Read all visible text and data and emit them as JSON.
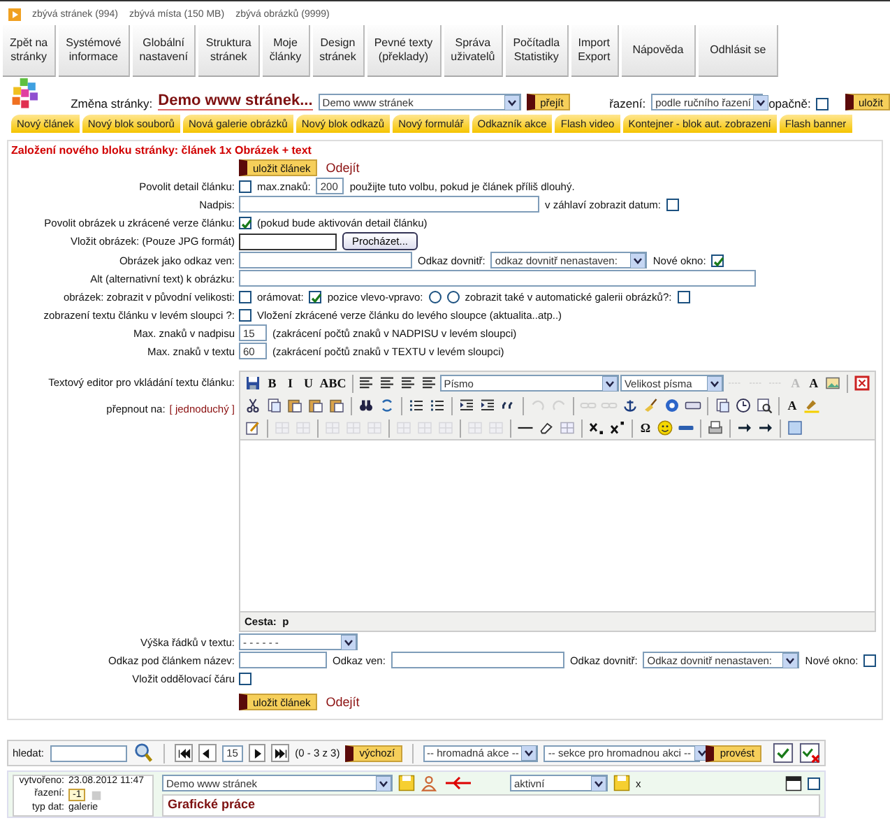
{
  "top_info": [
    "zbývá stránek (994)",
    "zbývá místa (150 MB)",
    "zbývá obrázků (9999)"
  ],
  "nav": [
    {
      "lines": [
        "Zpět na",
        "stránky"
      ]
    },
    {
      "lines": [
        "Systémové",
        "informace"
      ]
    },
    {
      "lines": [
        "Globální",
        "nastavení"
      ]
    },
    {
      "lines": [
        "Struktura",
        "stránek"
      ]
    },
    {
      "lines": [
        "Moje",
        "články"
      ]
    },
    {
      "lines": [
        "Design",
        "stránek"
      ]
    },
    {
      "lines": [
        "Pevné texty",
        "(překlady)"
      ]
    },
    {
      "lines": [
        "Správa",
        "uživatelů"
      ]
    },
    {
      "lines": [
        "Počítadla",
        "Statistiky"
      ]
    },
    {
      "lines": [
        "Import",
        "Export"
      ]
    },
    {
      "lines": [
        "Nápověda"
      ]
    },
    {
      "lines": [
        "Odhlásit se"
      ]
    }
  ],
  "page_switch": {
    "label": "Změna stránky:",
    "title": "Demo www stránek...",
    "select": "Demo www stránek",
    "go": "přejít",
    "sort_label": "řazení:",
    "sort_select": "podle ručního řazení",
    "reverse_label": "opačně:",
    "reverse_checked": false,
    "save": "uložit"
  },
  "new_block_buttons": [
    "Nový článek",
    "Nový blok souborů",
    "Nová galerie obrázků",
    "Nový blok odkazů",
    "Nový formulář",
    "Odkazník akce",
    "Flash video",
    "Kontejner - blok aut. zobrazení",
    "Flash banner"
  ],
  "form": {
    "title": "Založení nového bloku stránky: článek 1x Obrázek + text",
    "save": "uložit článek",
    "cancel": "Odejít",
    "save_bottom": "uložit článek",
    "cancel_bottom": "Odejít",
    "rows_top": [
      {
        "label": "Povolit detail článku:",
        "parts": [
          {
            "kind": "checkbox",
            "checked": false
          },
          {
            "kind": "text",
            "text": "max.znaků:"
          },
          {
            "kind": "input_tiny",
            "value": "200"
          },
          {
            "kind": "text",
            "text": "použijte tuto volbu, pokud je článek příliš dlouhý."
          }
        ]
      },
      {
        "label": "Nadpis:",
        "parts": [
          {
            "kind": "input_long"
          },
          {
            "kind": "text",
            "text": "v záhlaví zobrazit datum:"
          },
          {
            "kind": "checkbox",
            "checked": false
          }
        ]
      },
      {
        "label": "Povolit obrázek u zkrácené verze článku:",
        "parts": [
          {
            "kind": "checkbox",
            "checked": true
          },
          {
            "kind": "text",
            "text": "(pokud bude aktivován detail článku)"
          }
        ]
      },
      {
        "label": "Vložit obrázek: (Pouze JPG formát)",
        "parts": [
          {
            "kind": "input_file"
          },
          {
            "kind": "button",
            "label": "Procházet..."
          }
        ]
      },
      {
        "label": "Obrázek jako odkaz ven:",
        "parts": [
          {
            "kind": "input_mid"
          },
          {
            "kind": "text",
            "text": "Odkaz dovnitř:"
          },
          {
            "kind": "select",
            "value": "odkaz dovnitř nenastaven:"
          },
          {
            "kind": "text",
            "text": "Nové okno:"
          },
          {
            "kind": "checkbox",
            "checked": true
          }
        ]
      },
      {
        "label": "Alt (alternativní text) k obrázku:",
        "parts": [
          {
            "kind": "input_wide"
          }
        ]
      },
      {
        "label": "obrázek: zobrazit v původní velikosti:",
        "parts": [
          {
            "kind": "checkbox",
            "checked": false
          },
          {
            "kind": "text",
            "text": "orámovat:"
          },
          {
            "kind": "checkbox",
            "checked": true
          },
          {
            "kind": "text",
            "text": "pozice vlevo-vpravo:"
          },
          {
            "kind": "radio",
            "selected": false
          },
          {
            "kind": "radio",
            "selected": false
          },
          {
            "kind": "text",
            "text": "zobrazit také v automatické galerii obrázků?:"
          },
          {
            "kind": "checkbox",
            "checked": false
          }
        ]
      },
      {
        "label": "zobrazení textu článku v levém sloupci ?:",
        "parts": [
          {
            "kind": "checkbox",
            "checked": false
          },
          {
            "kind": "text",
            "text": "Vložení zkrácené verze článku do levého sloupce (aktualita..atp..)"
          }
        ]
      },
      {
        "label": "Max. znaků v nadpisu",
        "parts": [
          {
            "kind": "input_tiny",
            "value": "15"
          },
          {
            "kind": "text",
            "text": "(zakrácení počtů znaků v NADPISU v levém sloupci)"
          }
        ]
      },
      {
        "label": "Max. znaků v textu",
        "parts": [
          {
            "kind": "input_tiny",
            "value": "60"
          },
          {
            "kind": "text",
            "text": "(zakrácení počtů znaků v TEXTU v levém sloupci)"
          }
        ]
      }
    ],
    "editor": {
      "label": "Textový editor pro vkládání textu článku:",
      "switch_label": "přepnout na:",
      "switch_link": "[ jednoduchý ]",
      "path": "Cesta:  p",
      "toolbar": [
        [
          {
            "kind": "icon",
            "disabled": false
          },
          {
            "kind": "letter",
            "label": "B",
            "disabled": false
          },
          {
            "kind": "letter",
            "label": "I",
            "disabled": false
          },
          {
            "kind": "letter",
            "label": "U",
            "disabled": false
          },
          {
            "kind": "letter",
            "label": "ABC",
            "disabled": false
          },
          {
            "kind": "sep"
          },
          {
            "kind": "icon",
            "disabled": false
          },
          {
            "kind": "icon",
            "disabled": false
          },
          {
            "kind": "icon",
            "disabled": false
          },
          {
            "kind": "icon",
            "disabled": false
          },
          {
            "kind": "select",
            "value": "Písmo"
          },
          {
            "kind": "select",
            "value": "Velikost písma"
          },
          {
            "kind": "icon",
            "disabled": true
          },
          {
            "kind": "icon",
            "disabled": true
          },
          {
            "kind": "icon",
            "disabled": true
          },
          {
            "kind": "letter",
            "label": "A",
            "disabled": true
          },
          {
            "kind": "letter",
            "label": "A",
            "disabled": false
          },
          {
            "kind": "icon",
            "disabled": false
          },
          {
            "kind": "sep"
          },
          {
            "kind": "icon",
            "disabled": false
          }
        ],
        [
          {
            "kind": "icon",
            "disabled": false
          },
          {
            "kind": "icon",
            "disabled": false
          },
          {
            "kind": "icon",
            "disabled": false
          },
          {
            "kind": "icon",
            "disabled": false
          },
          {
            "kind": "icon",
            "disabled": false
          },
          {
            "kind": "sep"
          },
          {
            "kind": "icon",
            "disabled": false
          },
          {
            "kind": "icon",
            "disabled": false
          },
          {
            "kind": "sep"
          },
          {
            "kind": "icon",
            "disabled": false
          },
          {
            "kind": "icon",
            "disabled": false
          },
          {
            "kind": "sep"
          },
          {
            "kind": "icon",
            "disabled": false
          },
          {
            "kind": "icon",
            "disabled": false
          },
          {
            "kind": "icon",
            "disabled": false
          },
          {
            "kind": "sep"
          },
          {
            "kind": "icon",
            "disabled": true
          },
          {
            "kind": "icon",
            "disabled": true
          },
          {
            "kind": "sep"
          },
          {
            "kind": "icon",
            "disabled": true
          },
          {
            "kind": "icon",
            "disabled": true
          },
          {
            "kind": "icon",
            "disabled": false
          },
          {
            "kind": "icon",
            "disabled": false
          },
          {
            "kind": "icon",
            "disabled": false
          },
          {
            "kind": "icon",
            "disabled": false
          },
          {
            "kind": "sep"
          },
          {
            "kind": "icon",
            "disabled": false
          },
          {
            "kind": "icon",
            "disabled": false
          },
          {
            "kind": "icon",
            "disabled": false
          },
          {
            "kind": "sep"
          },
          {
            "kind": "letter",
            "label": "A",
            "disabled": false
          },
          {
            "kind": "icon",
            "disabled": false
          }
        ],
        [
          {
            "kind": "icon",
            "disabled": false
          },
          {
            "kind": "sep"
          },
          {
            "kind": "icon",
            "disabled": true
          },
          {
            "kind": "icon",
            "disabled": true
          },
          {
            "kind": "sep"
          },
          {
            "kind": "icon",
            "disabled": true
          },
          {
            "kind": "icon",
            "disabled": true
          },
          {
            "kind": "icon",
            "disabled": true
          },
          {
            "kind": "sep"
          },
          {
            "kind": "icon",
            "disabled": true
          },
          {
            "kind": "icon",
            "disabled": true
          },
          {
            "kind": "icon",
            "disabled": true
          },
          {
            "kind": "sep"
          },
          {
            "kind": "icon",
            "disabled": true
          },
          {
            "kind": "icon",
            "disabled": true
          },
          {
            "kind": "sep"
          },
          {
            "kind": "icon",
            "disabled": false
          },
          {
            "kind": "icon",
            "disabled": false
          },
          {
            "kind": "icon",
            "disabled": false
          },
          {
            "kind": "sep"
          },
          {
            "kind": "icon",
            "disabled": false
          },
          {
            "kind": "icon",
            "disabled": false
          },
          {
            "kind": "sep"
          },
          {
            "kind": "letter",
            "label": "Ω",
            "disabled": false
          },
          {
            "kind": "icon",
            "disabled": false
          },
          {
            "kind": "icon",
            "disabled": false
          },
          {
            "kind": "sep"
          },
          {
            "kind": "icon",
            "disabled": false
          },
          {
            "kind": "sep"
          },
          {
            "kind": "icon",
            "disabled": false
          },
          {
            "kind": "icon",
            "disabled": false
          },
          {
            "kind": "sep"
          },
          {
            "kind": "icon",
            "disabled": false
          }
        ]
      ]
    },
    "rows_bottom": [
      {
        "label": "Výška řádků v textu:",
        "parts": [
          {
            "kind": "select_mid",
            "value": "- - - - - -"
          }
        ]
      },
      {
        "label": "Odkaz pod článkem název:",
        "parts": [
          {
            "kind": "input_small"
          },
          {
            "kind": "text",
            "text": "Odkaz ven:"
          },
          {
            "kind": "input_mid"
          },
          {
            "kind": "text",
            "text": "Odkaz dovnitř:"
          },
          {
            "kind": "select",
            "value": "Odkaz dovnitř nenastaven:"
          },
          {
            "kind": "text",
            "text": "Nové okno:"
          },
          {
            "kind": "checkbox",
            "checked": false
          }
        ]
      },
      {
        "label": "Vložit oddělovací čáru",
        "parts": [
          {
            "kind": "checkbox",
            "checked": false
          }
        ]
      }
    ]
  },
  "list_toolbar": {
    "search_label": "hledat:",
    "page": "15",
    "range": "(0 - 3 z 3)",
    "default": "výchozí",
    "bulk_action": "-- hromadná akce --",
    "bulk_section": "-- sekce pro hromadnou akci --",
    "run": "provést"
  },
  "item": {
    "created_label": "vytvořeno:",
    "created": "23.08.2012 11:47",
    "order_label": "řazení:",
    "order": "-1",
    "type_label": "typ dat:",
    "type": "galerie",
    "page_select": "Demo www stránek",
    "status_select": "aktivní",
    "close": "x",
    "selected": false,
    "title": "Grafické práce"
  }
}
